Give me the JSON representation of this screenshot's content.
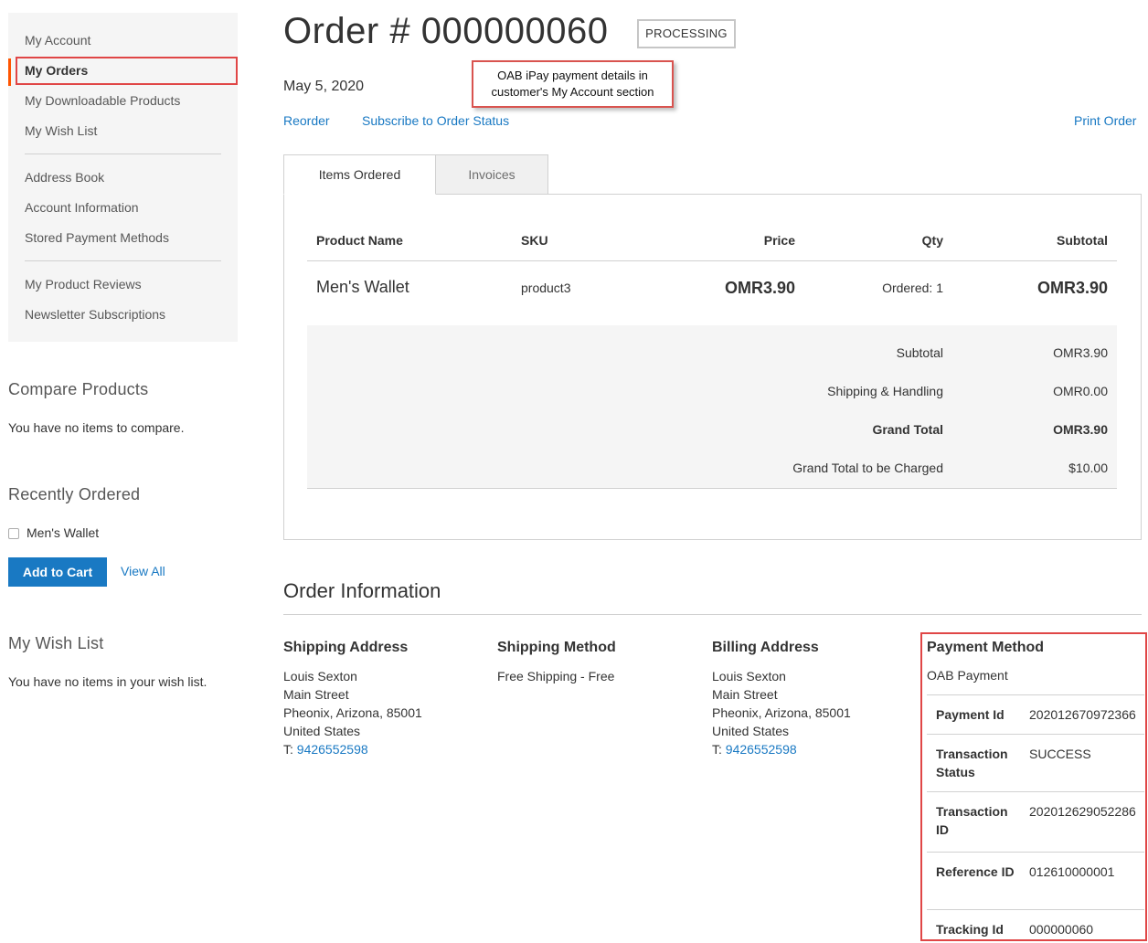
{
  "sidebar": {
    "nav": [
      {
        "label": "My Account"
      },
      {
        "label": "My Orders"
      },
      {
        "label": "My Downloadable Products"
      },
      {
        "label": "My Wish List"
      },
      {
        "label": "Address Book"
      },
      {
        "label": "Account Information"
      },
      {
        "label": "Stored Payment Methods"
      },
      {
        "label": "My Product Reviews"
      },
      {
        "label": "Newsletter Subscriptions"
      }
    ],
    "compare": {
      "title": "Compare Products",
      "empty": "You have no items to compare."
    },
    "recent": {
      "title": "Recently Ordered",
      "item": "Men's Wallet",
      "add_to_cart": "Add to Cart",
      "view_all": "View All"
    },
    "wishlist": {
      "title": "My Wish List",
      "empty": "You have no items in your wish list."
    }
  },
  "order": {
    "title": "Order # 000000060",
    "status": "PROCESSING",
    "date": "May 5, 2020",
    "callout": "OAB iPay payment details in customer's My Account section",
    "actions": {
      "reorder": "Reorder",
      "subscribe": "Subscribe to Order Status",
      "print": "Print Order"
    },
    "tabs": [
      {
        "label": "Items Ordered"
      },
      {
        "label": "Invoices"
      }
    ],
    "table": {
      "headers": {
        "name": "Product Name",
        "sku": "SKU",
        "price": "Price",
        "qty": "Qty",
        "subtotal": "Subtotal"
      },
      "rows": [
        {
          "name": "Men's Wallet",
          "sku": "product3",
          "price": "OMR3.90",
          "qty": "Ordered: 1",
          "subtotal": "OMR3.90"
        }
      ]
    },
    "totals": [
      {
        "label": "Subtotal",
        "value": "OMR3.90"
      },
      {
        "label": "Shipping & Handling",
        "value": "OMR0.00"
      },
      {
        "label": "Grand Total",
        "value": "OMR3.90"
      },
      {
        "label": "Grand Total to be Charged",
        "value": "$10.00"
      }
    ]
  },
  "info": {
    "title": "Order Information",
    "shipping_address": {
      "title": "Shipping Address",
      "name": "Louis Sexton",
      "street": "Main Street",
      "city": "Pheonix, Arizona, 85001",
      "country": "United States",
      "phone_prefix": "T: ",
      "phone": "9426552598"
    },
    "shipping_method": {
      "title": "Shipping Method",
      "value": "Free Shipping - Free"
    },
    "billing_address": {
      "title": "Billing Address",
      "name": "Louis Sexton",
      "street": "Main Street",
      "city": "Pheonix, Arizona, 85001",
      "country": "United States",
      "phone_prefix": "T: ",
      "phone": "9426552598"
    },
    "payment": {
      "title": "Payment Method",
      "method": "OAB Payment",
      "rows": [
        {
          "label": "Payment Id",
          "value": "202012670972366"
        },
        {
          "label": "Transaction Status",
          "value": "SUCCESS"
        },
        {
          "label": "Transaction ID",
          "value": "202012629052286"
        },
        {
          "label": "Reference ID",
          "value": "012610000001"
        },
        {
          "label": "Tracking Id",
          "value": "000000060"
        }
      ]
    }
  }
}
